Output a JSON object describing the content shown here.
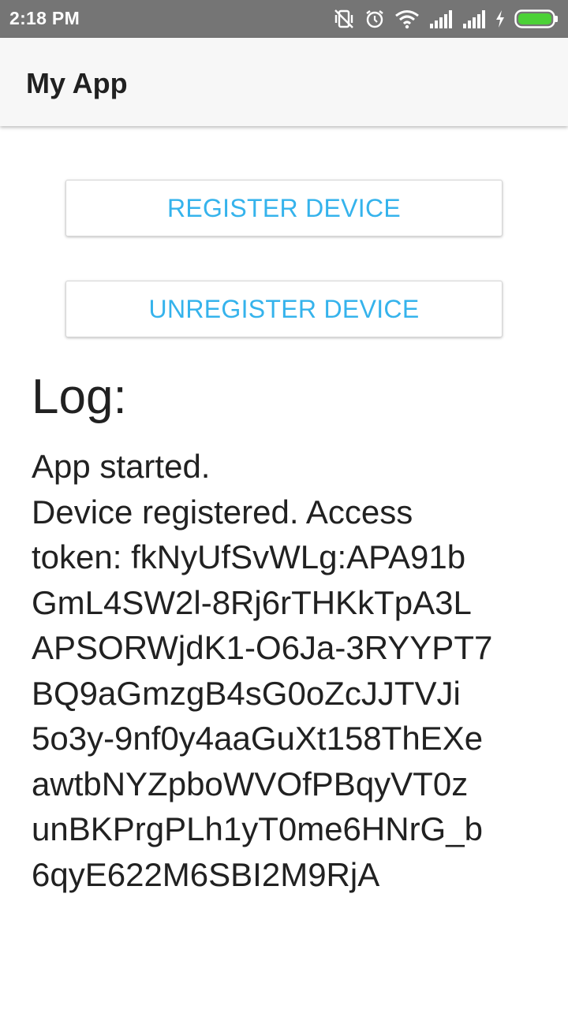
{
  "status_bar": {
    "time": "2:18 PM",
    "icons": [
      "vibrate-off-icon",
      "alarm-icon",
      "wifi-icon",
      "signal-icon",
      "signal-icon",
      "charging-icon",
      "battery-icon"
    ]
  },
  "app_bar": {
    "title": "My App"
  },
  "buttons": {
    "register": "REGISTER DEVICE",
    "unregister": "UNREGISTER DEVICE"
  },
  "log": {
    "title": "Log:",
    "lines": [
      "App started.",
      "Device registered. Access",
      "token: fkNyUfSvWLg:APA91b",
      "GmL4SW2l-8Rj6rTHKkTpA3L",
      "APSORWjdK1-O6Ja-3RYYPT7",
      "BQ9aGmzgB4sG0oZcJJTVJi",
      "5o3y-9nf0y4aaGuXt158ThEXe",
      "awtbNYZpboWVOfPBqyVT0z",
      "unBKPrgPLh1yT0me6HNrG_b",
      "6qyE622M6SBI2M9RjA"
    ]
  },
  "colors": {
    "status_bar": "#757575",
    "app_bar": "#f7f7f7",
    "button_text": "#35b3ec",
    "battery": "#4cd137"
  }
}
